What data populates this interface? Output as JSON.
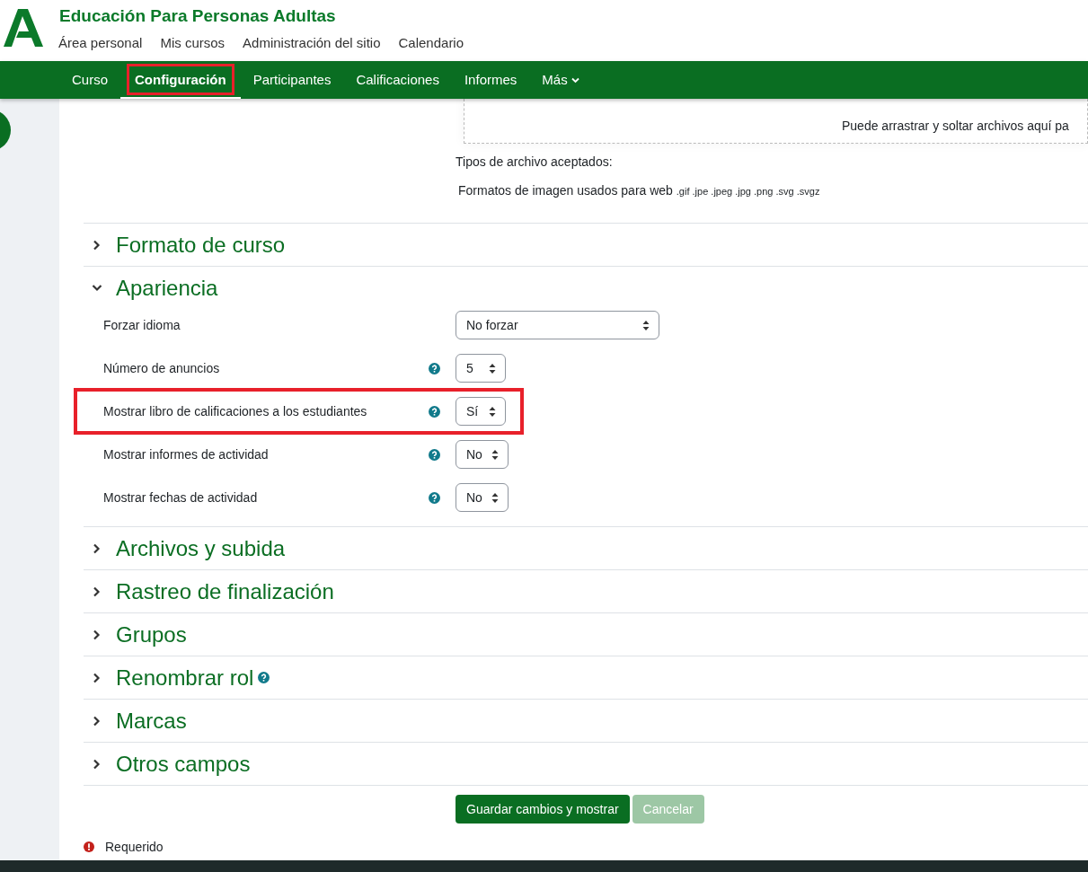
{
  "site": {
    "title": "Educación Para Personas Adultas",
    "links": [
      "Área personal",
      "Mis cursos",
      "Administración del sitio",
      "Calendario"
    ]
  },
  "tabs": [
    {
      "label": "Curso",
      "selected": false,
      "highlighted": false,
      "dropdown": false
    },
    {
      "label": "Configuración",
      "selected": true,
      "highlighted": true,
      "dropdown": false
    },
    {
      "label": "Participantes",
      "selected": false,
      "highlighted": false,
      "dropdown": false
    },
    {
      "label": "Calificaciones",
      "selected": false,
      "highlighted": false,
      "dropdown": false
    },
    {
      "label": "Informes",
      "selected": false,
      "highlighted": false,
      "dropdown": false
    },
    {
      "label": "Más",
      "selected": false,
      "highlighted": false,
      "dropdown": true
    }
  ],
  "upload": {
    "drop_hint": "Puede arrastrar y soltar archivos aquí pa",
    "accepted_label": "Tipos de archivo aceptados:",
    "formats_label": "Formatos de imagen usados para web",
    "extensions": ".gif .jpe .jpeg .jpg .png .svg .svgz"
  },
  "sections": [
    {
      "title": "Formato de curso",
      "expanded": false,
      "help": false
    },
    {
      "title": "Apariencia",
      "expanded": true,
      "help": false,
      "fields": [
        {
          "label": "Forzar idioma",
          "help": false,
          "value": "No forzar",
          "wide": true,
          "highlighted": false
        },
        {
          "label": "Número de anuncios",
          "help": true,
          "value": "5",
          "wide": false,
          "highlighted": false
        },
        {
          "label": "Mostrar libro de calificaciones a los estudiantes",
          "help": true,
          "value": "Sí",
          "wide": false,
          "highlighted": true
        },
        {
          "label": "Mostrar informes de actividad",
          "help": true,
          "value": "No",
          "wide": false,
          "highlighted": false
        },
        {
          "label": "Mostrar fechas de actividad",
          "help": true,
          "value": "No",
          "wide": false,
          "highlighted": false
        }
      ]
    },
    {
      "title": "Archivos y subida",
      "expanded": false,
      "help": false
    },
    {
      "title": "Rastreo de finalización",
      "expanded": false,
      "help": false
    },
    {
      "title": "Grupos",
      "expanded": false,
      "help": false
    },
    {
      "title": "Renombrar rol",
      "expanded": false,
      "help": true
    },
    {
      "title": "Marcas",
      "expanded": false,
      "help": false
    },
    {
      "title": "Otros campos",
      "expanded": false,
      "help": false
    }
  ],
  "buttons": [
    {
      "label": "Guardar cambios y mostrar",
      "disabled": false
    },
    {
      "label": "Cancelar",
      "disabled": true
    }
  ],
  "required_note": "Requerido"
}
